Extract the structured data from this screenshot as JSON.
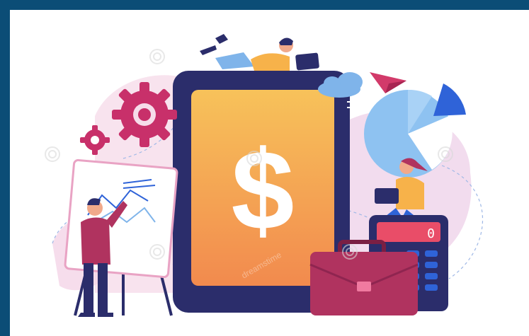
{
  "illustration": {
    "currency_symbol": "$",
    "calculator_display": "0",
    "colors": {
      "frame": "#0b4d76",
      "background": "#ffffff",
      "tablet_body": "#2b2d6b",
      "screen_top": "#f7c25a",
      "screen_bottom": "#f28a4e",
      "pie_chart": "#8ec2f1",
      "pie_slice": "#2f63d8",
      "gear": "#c8306a",
      "briefcase": "#b0335f",
      "calculator_display_bg": "#e94d68",
      "paper_plane": "#d23a6a"
    },
    "watermark_text": "dreamstime"
  }
}
